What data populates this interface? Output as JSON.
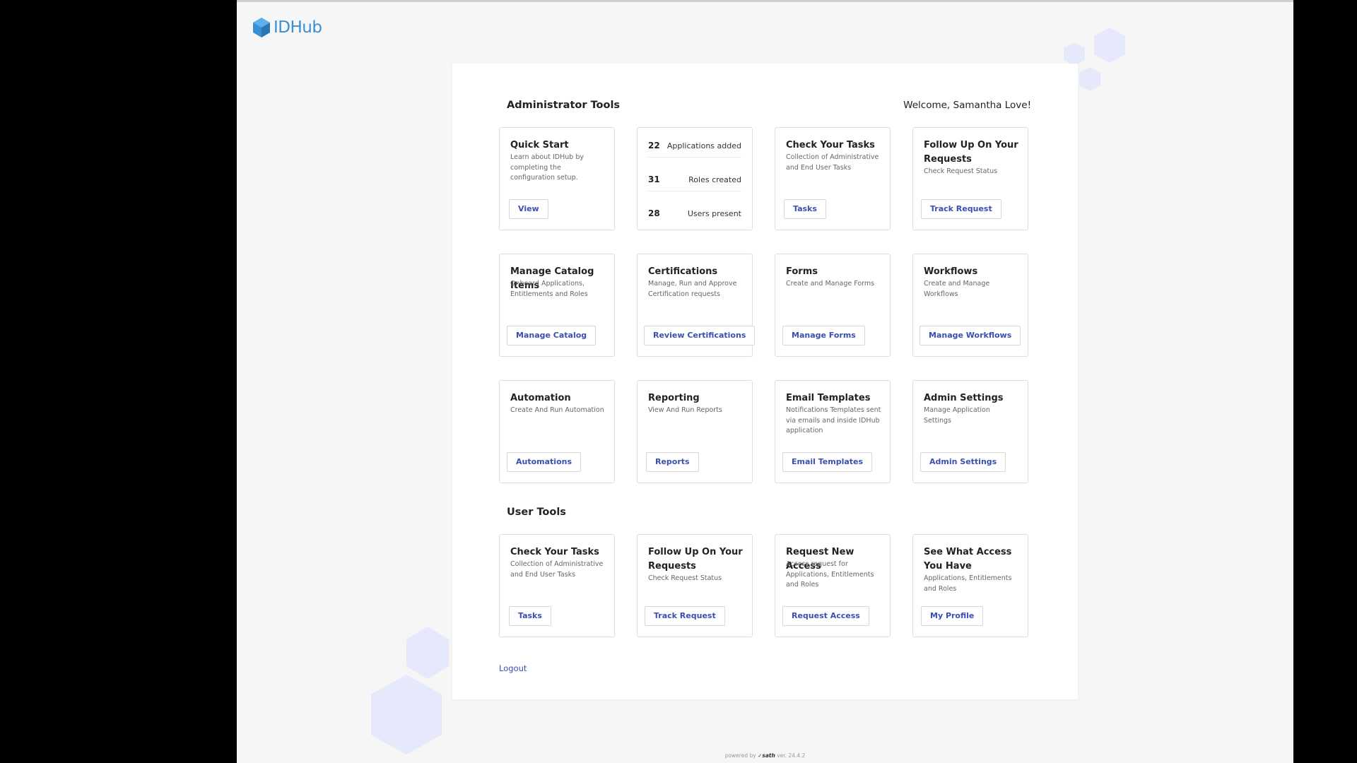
{
  "brand": {
    "name": "IDHub",
    "color": "#3a8fd3"
  },
  "header": {
    "welcome": "Welcome, Samantha Love!"
  },
  "admin_tools": {
    "title": "Administrator Tools",
    "quick_start": {
      "title": "Quick Start",
      "desc": "Learn about IDHub by completing the configuration setup.",
      "button": "View"
    },
    "stats": [
      {
        "value": "22",
        "label": "Applications added"
      },
      {
        "value": "31",
        "label": "Roles created"
      },
      {
        "value": "28",
        "label": "Users present"
      }
    ],
    "check_tasks": {
      "title": "Check Your Tasks",
      "desc": "Collection of Administrative and End User Tasks",
      "button": "Tasks"
    },
    "follow_up": {
      "title": "Follow Up On Your Requests",
      "desc": "Check Request Status",
      "button": "Track Request"
    },
    "catalog": {
      "title": "Manage Catalog Items",
      "desc": "Onboard Applications, Entitlements and Roles",
      "button": "Manage Catalog"
    },
    "certifications": {
      "title": "Certifications",
      "desc": "Manage, Run and Approve Certification requests",
      "button": "Review Certifications"
    },
    "forms": {
      "title": "Forms",
      "desc": "Create and Manage Forms",
      "button": "Manage Forms"
    },
    "workflows": {
      "title": "Workflows",
      "desc": "Create and Manage Workflows",
      "button": "Manage Workflows"
    },
    "automation": {
      "title": "Automation",
      "desc": "Create And Run Automation",
      "button": "Automations"
    },
    "reporting": {
      "title": "Reporting",
      "desc": "View And Run Reports",
      "button": "Reports"
    },
    "email_templates": {
      "title": "Email Templates",
      "desc": "Notifications Templates sent via emails and inside IDHub application",
      "button": "Email Templates"
    },
    "admin_settings": {
      "title": "Admin Settings",
      "desc": "Manage Application Settings",
      "button": "Admin Settings"
    }
  },
  "user_tools": {
    "title": "User Tools",
    "check_tasks": {
      "title": "Check Your Tasks",
      "desc": "Collection of Administrative and End User Tasks",
      "button": "Tasks"
    },
    "follow_up": {
      "title": "Follow Up On Your Requests",
      "desc": "Check Request Status",
      "button": "Track Request"
    },
    "request_access": {
      "title": "Request New Access",
      "desc": "Access request for Applications, Entitlements and Roles",
      "button": "Request Access"
    },
    "see_access": {
      "title": "See What Access You Have",
      "desc": "Applications, Entitlements and Roles",
      "button": "My Profile"
    }
  },
  "logout": "Logout",
  "footer": {
    "powered_by": "powered by",
    "vendor": "sath",
    "version": "ver. 24.4.2"
  },
  "colors": {
    "accent": "#3a4fb0",
    "hexagon": "#e6e8fb"
  }
}
